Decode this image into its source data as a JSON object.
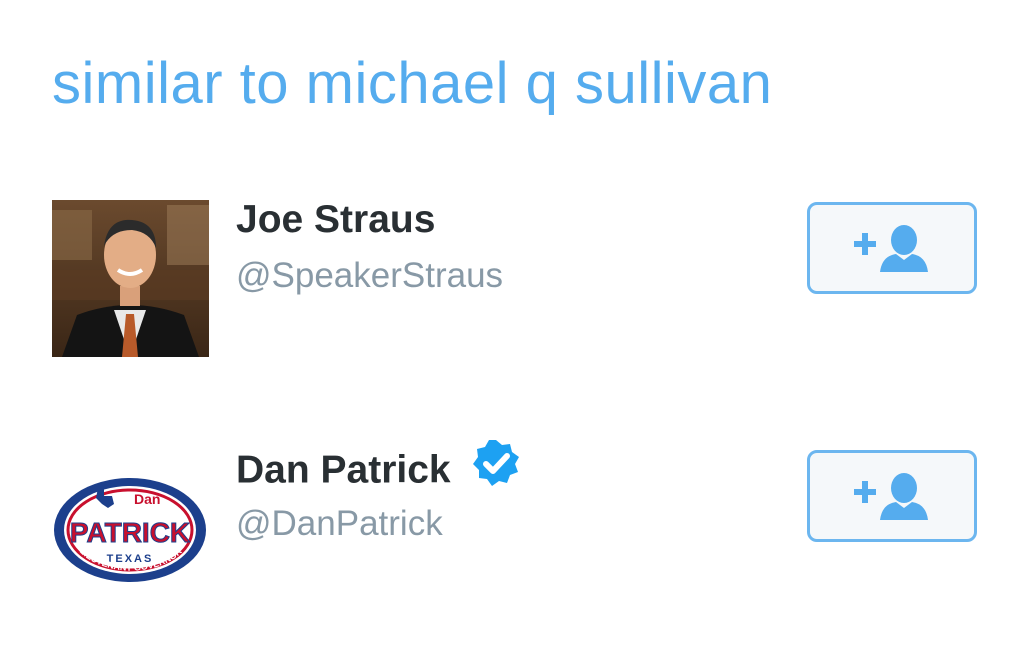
{
  "header": {
    "title": "similar to michael q sullivan"
  },
  "accounts": [
    {
      "name": "Joe Straus",
      "handle": "@SpeakerStraus",
      "verified": false,
      "avatar_icon": "profile-photo"
    },
    {
      "name": "Dan Patrick",
      "handle": "@DanPatrick",
      "verified": true,
      "avatar_icon": "campaign-logo",
      "logo_text": {
        "small": "Dan",
        "main": "PATRICK",
        "state": "TEXAS",
        "ring": "LIEUTENANT GOVERNOR"
      }
    }
  ],
  "colors": {
    "accent": "#55ACEE",
    "name_text": "#292F33",
    "handle_text": "#8899A6",
    "button_border": "#6CB6EF",
    "button_bg": "#F5F8FA"
  },
  "icons": {
    "follow": "add-user-icon",
    "verified": "verified-badge-icon"
  }
}
